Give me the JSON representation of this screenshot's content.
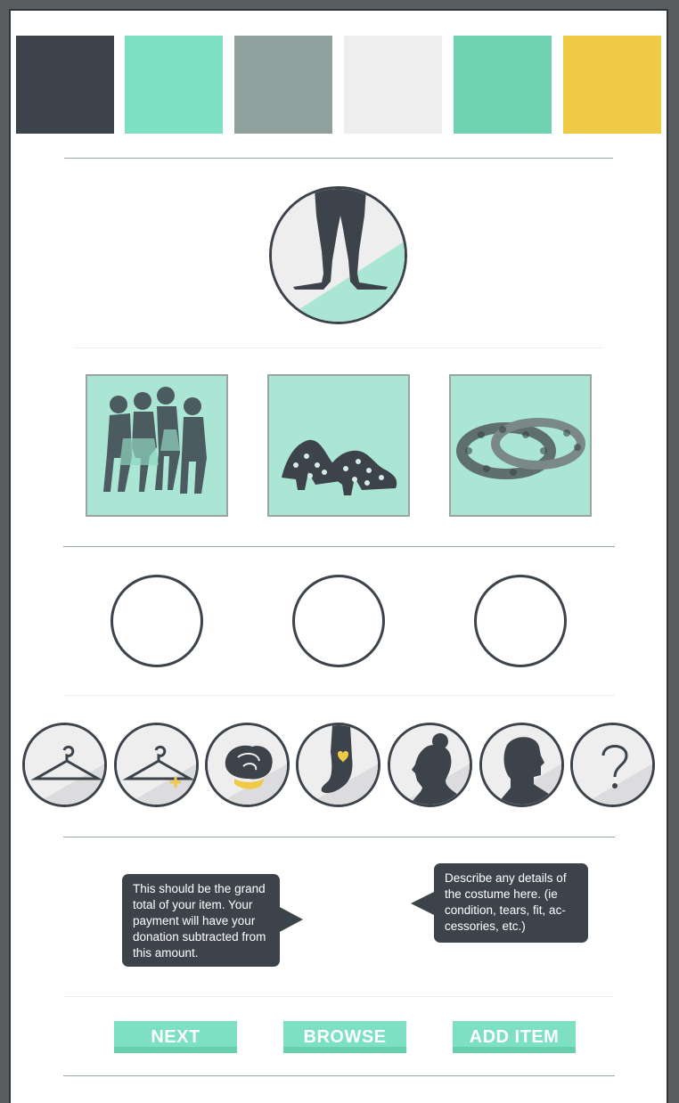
{
  "palette": {
    "colors": [
      "#3c434b",
      "#7de0c2",
      "#8fa09d",
      "#efeeef",
      "#6fd3b1",
      "#eeca47"
    ]
  },
  "hero": {
    "icon": "dancer-legs-icon",
    "accent": "#abe6d4"
  },
  "photos": [
    {
      "icon": "dancers-group-photo"
    },
    {
      "icon": "polka-dot-shoes-photo"
    },
    {
      "icon": "sequin-headbands-photo"
    }
  ],
  "categories": [
    {
      "icon": "hanger-icon"
    },
    {
      "icon": "hanger-plus-icon"
    },
    {
      "icon": "rose-icon"
    },
    {
      "icon": "foot-heart-icon"
    },
    {
      "icon": "woman-silhouette-icon"
    },
    {
      "icon": "man-silhouette-icon"
    },
    {
      "icon": "question-mark-icon"
    }
  ],
  "tooltips": {
    "price": "This should be the grand total of your item. Your payment will have your donation subtracted from this amount.",
    "details": "Describe any details of the costume here. (ie condition, tears, fit, ac-cessories, etc.)"
  },
  "buttons": {
    "next": "NEXT",
    "browse": "BROWSE",
    "add_item": "ADD ITEM"
  }
}
